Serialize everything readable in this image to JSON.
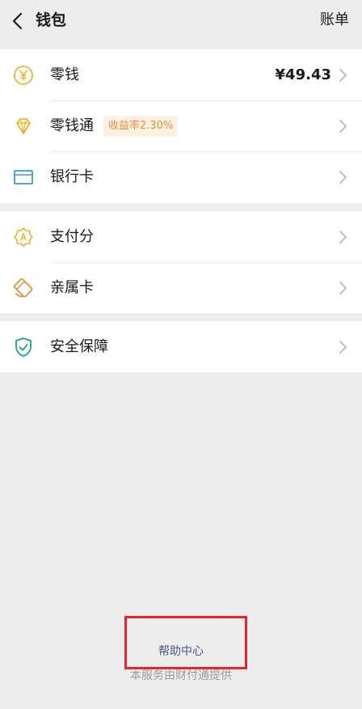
{
  "header": {
    "title": "钱包",
    "bill_label": "账单"
  },
  "groups": [
    {
      "items": [
        {
          "label": "零钱",
          "value": "¥49.43",
          "icon": "coin-icon"
        },
        {
          "label": "零钱通",
          "badge": "收益率2.30%",
          "icon": "diamond-icon"
        },
        {
          "label": "银行卡",
          "icon": "bank-card-icon"
        }
      ]
    },
    {
      "items": [
        {
          "label": "支付分",
          "icon": "pay-score-icon"
        },
        {
          "label": "亲属卡",
          "icon": "family-card-icon"
        }
      ]
    },
    {
      "items": [
        {
          "label": "安全保障",
          "icon": "shield-icon"
        }
      ]
    }
  ],
  "footer": {
    "help_label": "帮助中心",
    "note": "本服务由财付通提供"
  },
  "colors": {
    "background": "#ededed",
    "card": "#ffffff",
    "gold": "#e9b52c",
    "blue": "#3a9bd8",
    "orange": "#e0913d",
    "green": "#13a97a",
    "link": "#4a5b86",
    "highlight": "#e8242c"
  }
}
